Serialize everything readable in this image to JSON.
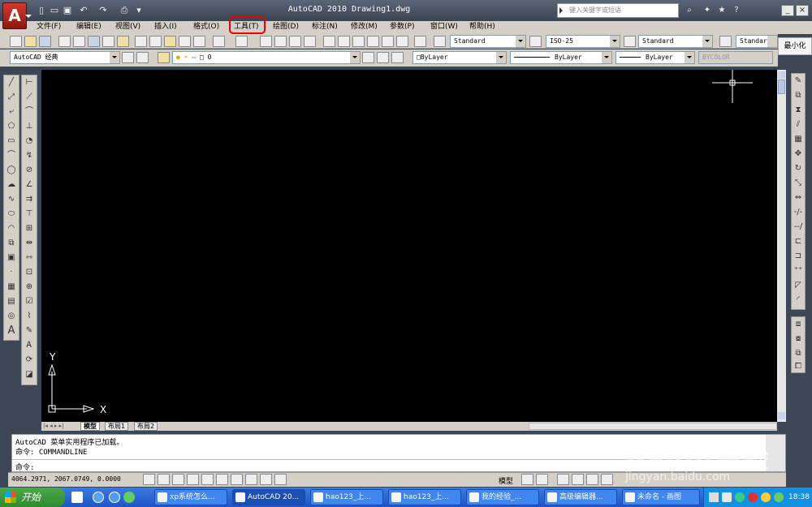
{
  "window": {
    "title": "AutoCAD 2010    Drawing1.dwg",
    "logo": "A",
    "search_placeholder": "键入关键字或短语"
  },
  "menu": [
    "文件(F)",
    "编辑(E)",
    "视图(V)",
    "插入(I)",
    "格式(O)",
    "工具(T)",
    "绘图(D)",
    "标注(N)",
    "修改(M)",
    "参数(P)",
    "窗口(W)",
    "帮助(H)"
  ],
  "toolbar": {
    "text_style": "Standard",
    "dim_style": "ISO-25",
    "table_style": "Standard",
    "multileader_style": "Standard"
  },
  "workspace": "AutoCAD 经典",
  "layer": "0",
  "properties": {
    "color": "ByLayer",
    "linetype": "ByLayer",
    "lineweight": "ByLayer",
    "plotstyle": "BYCOLOR"
  },
  "minimize_label": "最小化",
  "ucs": {
    "x_label": "X",
    "y_label": "Y"
  },
  "tabs": [
    "模型",
    "布局1",
    "布局2"
  ],
  "command": {
    "line1": "AutoCAD 菜单实用程序已加载。",
    "line2": "命令: COMMANDLINE",
    "prompt": "命令:"
  },
  "status": {
    "coords": "4064.2971, 2067.0749, 0.0000",
    "model_label": "模型"
  },
  "taskbar": {
    "start": "开始",
    "items": [
      "xp系统怎么...",
      "AutoCAD 20...",
      "hao123_上...",
      "hao123_上...",
      "我的经验_...",
      "高级编辑器...",
      "未命名 - 画图"
    ],
    "clock": "18:38"
  },
  "watermark": "Baidu经验",
  "watermark_url": "jingyan.baidu.com"
}
